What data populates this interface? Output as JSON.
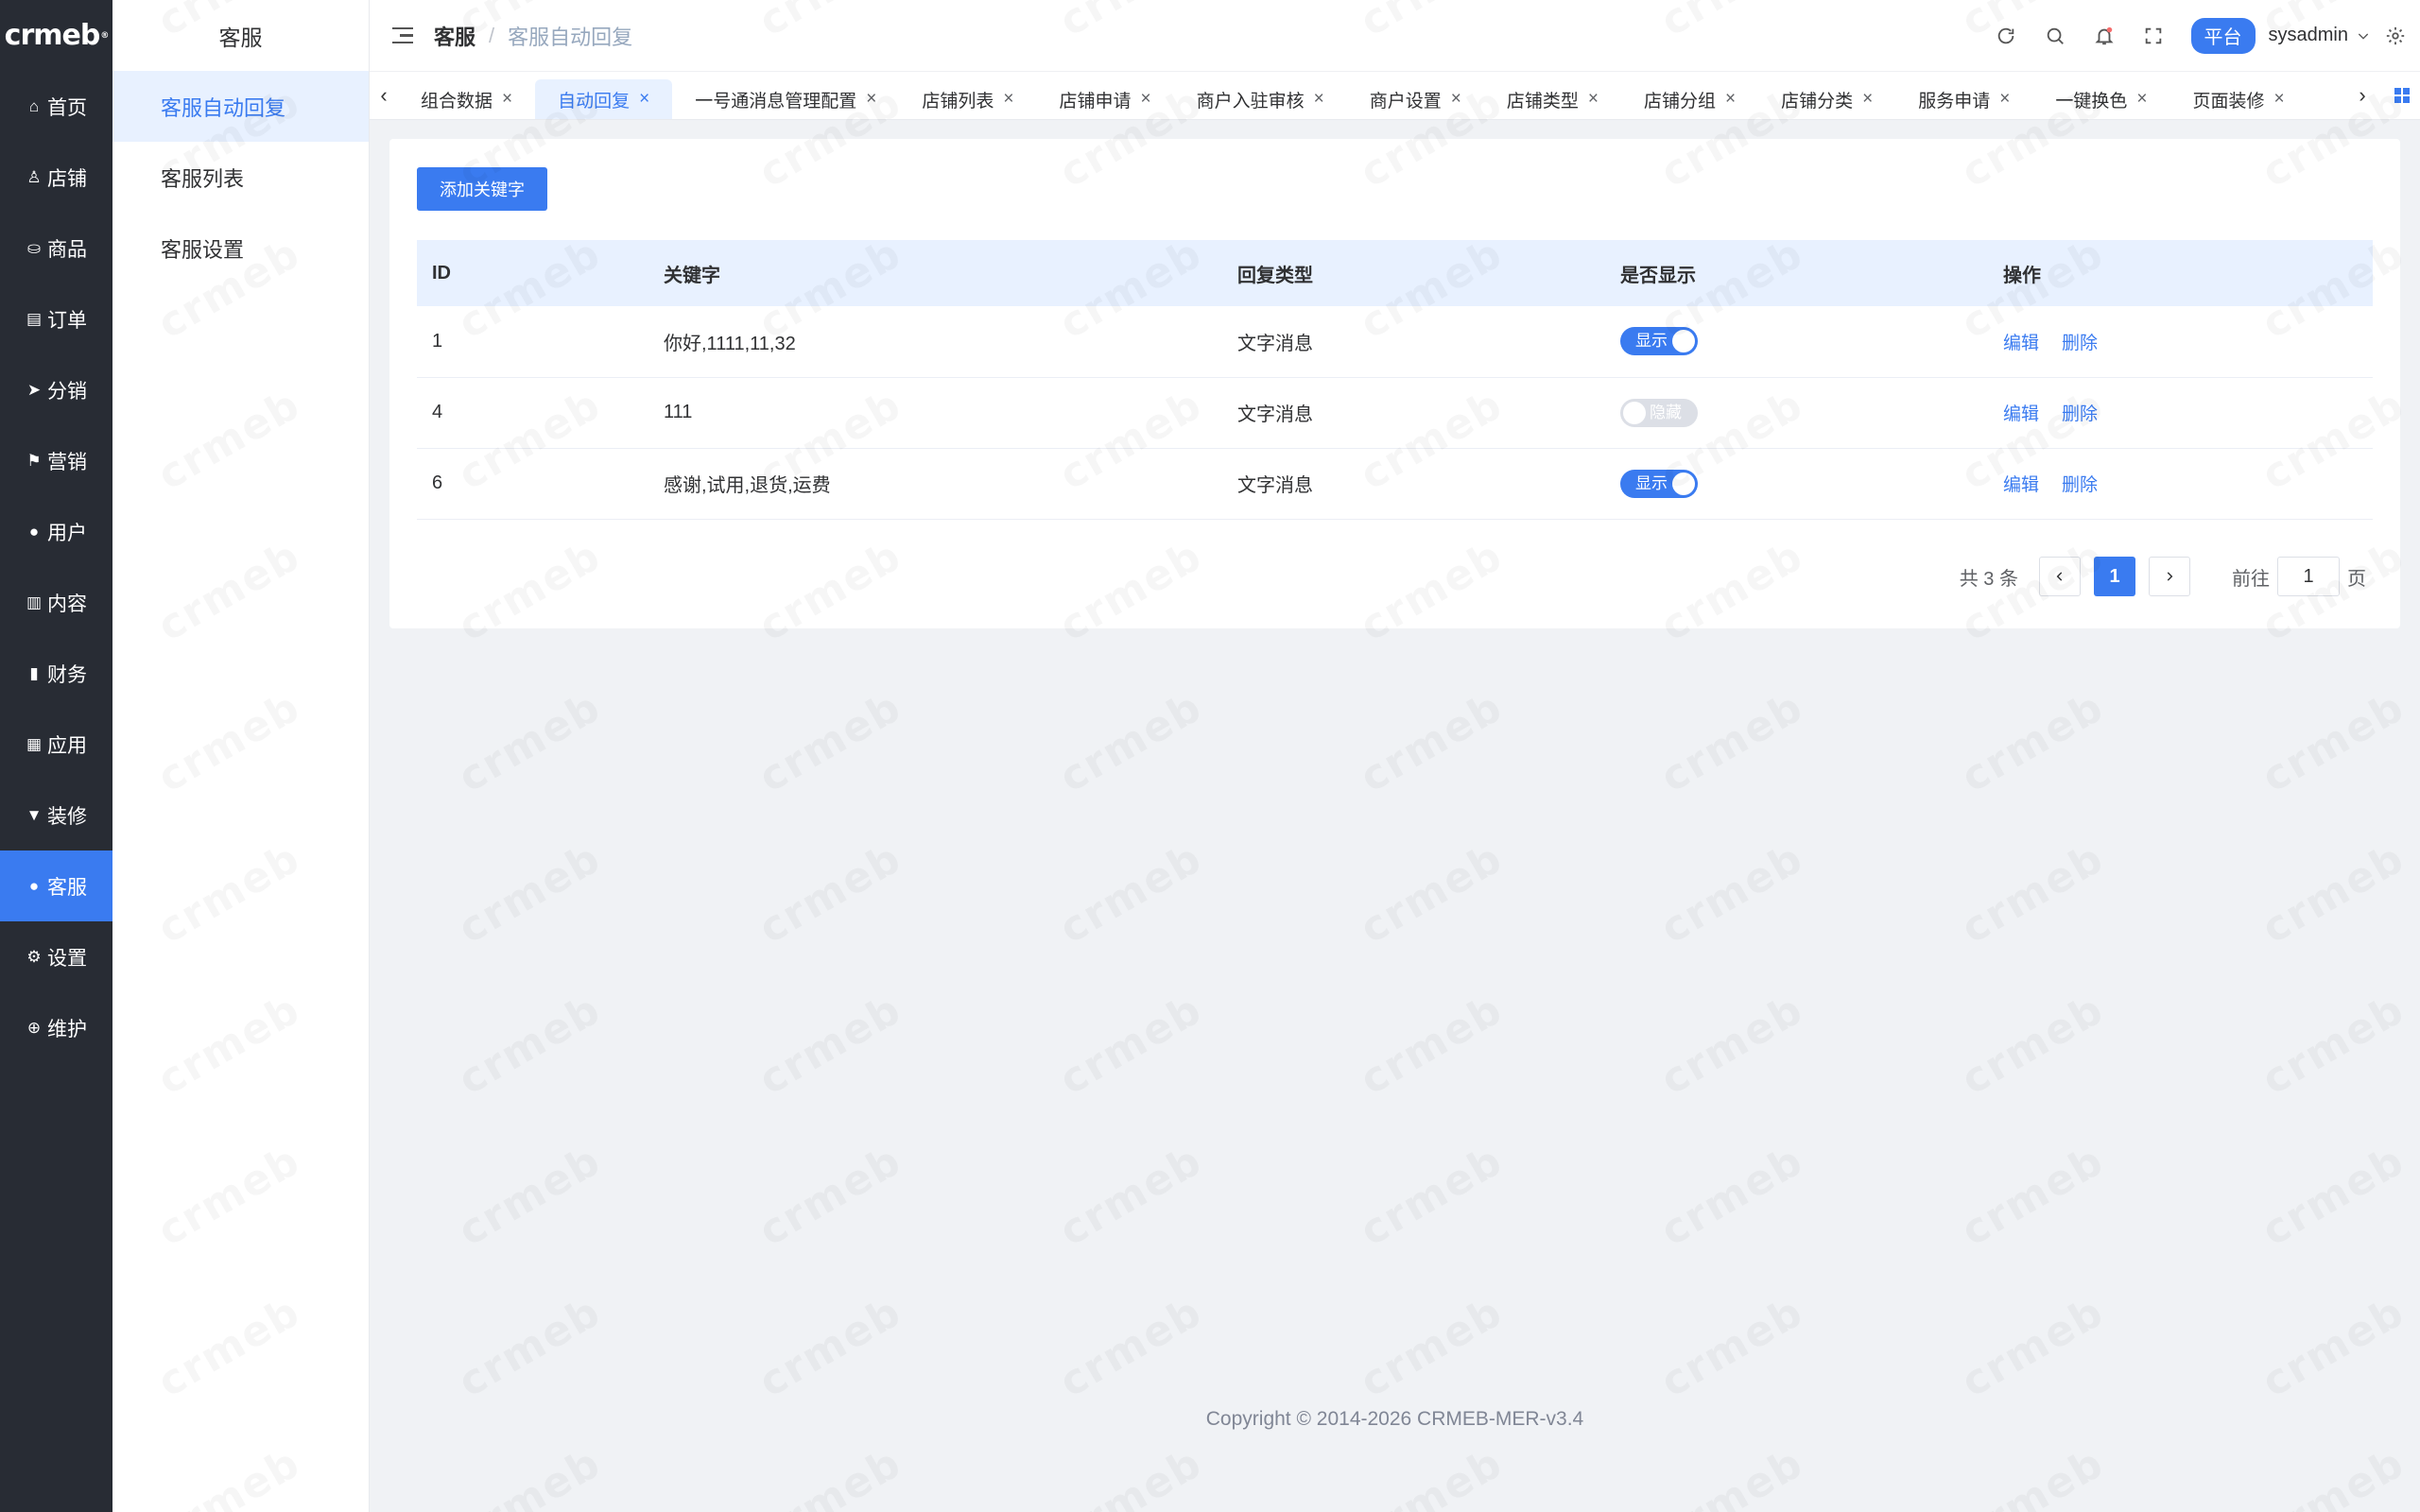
{
  "app": {
    "logo_text": "crmeb"
  },
  "rail": {
    "items": [
      {
        "label": "首页",
        "icon": "home-icon",
        "glyph": "⌂"
      },
      {
        "label": "店铺",
        "icon": "shop-user-icon",
        "glyph": "♙"
      },
      {
        "label": "商品",
        "icon": "bag-icon",
        "glyph": "⛀"
      },
      {
        "label": "订单",
        "icon": "clipboard-icon",
        "glyph": "▤"
      },
      {
        "label": "分销",
        "icon": "send-icon",
        "glyph": "➤"
      },
      {
        "label": "营销",
        "icon": "flag-icon",
        "glyph": "⚑"
      },
      {
        "label": "用户",
        "icon": "user-icon",
        "glyph": "●"
      },
      {
        "label": "内容",
        "icon": "book-icon",
        "glyph": "▥"
      },
      {
        "label": "财务",
        "icon": "bar-chart-icon",
        "glyph": "▮"
      },
      {
        "label": "应用",
        "icon": "grid-icon",
        "glyph": "▦"
      },
      {
        "label": "装修",
        "icon": "brush-icon",
        "glyph": "▼"
      },
      {
        "label": "客服",
        "icon": "user-icon",
        "glyph": "●",
        "active": true
      },
      {
        "label": "设置",
        "icon": "gear-icon",
        "glyph": "⚙"
      },
      {
        "label": "维护",
        "icon": "plus-circle-icon",
        "glyph": "⊕"
      }
    ]
  },
  "subnav": {
    "title": "客服",
    "items": [
      {
        "label": "客服自动回复",
        "active": true
      },
      {
        "label": "客服列表"
      },
      {
        "label": "客服设置"
      }
    ]
  },
  "header": {
    "breadcrumb_1": "客服",
    "breadcrumb_sep": "/",
    "breadcrumb_2": "客服自动回复",
    "platform_label": "平台",
    "username": "sysadmin"
  },
  "tabs": [
    {
      "label": "组合数据"
    },
    {
      "label": "自动回复",
      "active": true
    },
    {
      "label": "一号通消息管理配置"
    },
    {
      "label": "店铺列表"
    },
    {
      "label": "店铺申请"
    },
    {
      "label": "商户入驻审核"
    },
    {
      "label": "商户设置"
    },
    {
      "label": "店铺类型"
    },
    {
      "label": "店铺分组"
    },
    {
      "label": "店铺分类"
    },
    {
      "label": "服务申请"
    },
    {
      "label": "一键换色"
    },
    {
      "label": "页面装修"
    }
  ],
  "main": {
    "add_button": "添加关键字",
    "columns": [
      "ID",
      "关键字",
      "回复类型",
      "是否显示",
      "操作"
    ],
    "rows": [
      {
        "id": "1",
        "keyword": "你好,1111,11,32",
        "type": "文字消息",
        "show": true,
        "show_label": "显示"
      },
      {
        "id": "4",
        "keyword": "111",
        "type": "文字消息",
        "show": false,
        "show_label": "隐藏"
      },
      {
        "id": "6",
        "keyword": "感谢,试用,退货,运费",
        "type": "文字消息",
        "show": true,
        "show_label": "显示"
      }
    ],
    "edit_label": "编辑",
    "delete_label": "删除"
  },
  "pagination": {
    "total_text": "共 3 条",
    "current_page": "1",
    "goto_label": "前往",
    "goto_value": "1",
    "page_suffix": "页"
  },
  "footer": {
    "copyright": "Copyright © 2014-2026 CRMEB-MER-v3.4"
  },
  "colors": {
    "primary": "#3a7bf0",
    "rail_bg": "#282c34",
    "page_bg": "#f0f2f5"
  }
}
